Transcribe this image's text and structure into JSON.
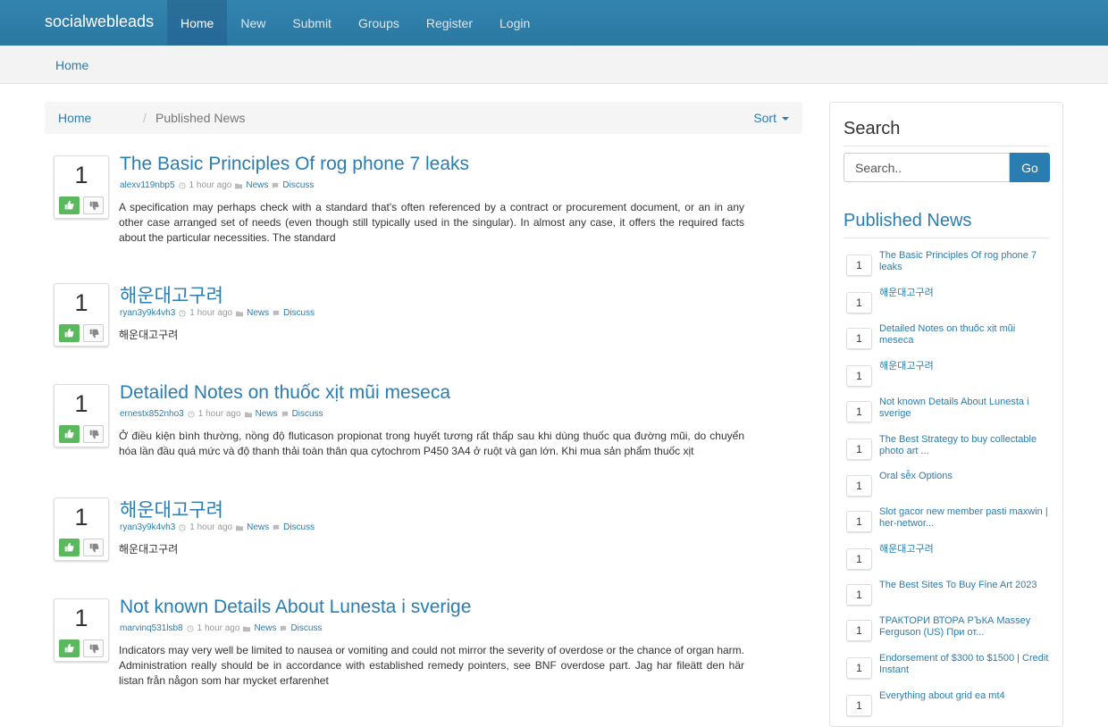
{
  "navbar": {
    "brand": "socialwebleads",
    "items": [
      "Home",
      "New",
      "Submit",
      "Groups",
      "Register",
      "Login"
    ]
  },
  "subheader": {
    "link": "Home"
  },
  "breadcrumb": {
    "home": "Home",
    "separator": "/",
    "current": "Published News",
    "sort": "Sort"
  },
  "posts": [
    {
      "votes": "1",
      "title": "The Basic Principles Of rog phone 7 leaks",
      "author": "alexv119nbp5",
      "time": "1 hour ago",
      "category": "News",
      "discuss": "Discuss",
      "excerpt": "A specification may perhaps check with a standard that's often referenced by a contract or procurement document, or an in any other case arranged set of needs (even though still typically used in the singular). In almost any case, it offers the required facts about the particular necessities. The standard"
    },
    {
      "votes": "1",
      "title": "해운대고구려",
      "author": "ryan3y9k4vh3",
      "time": "1 hour ago",
      "category": "News",
      "discuss": "Discuss",
      "excerpt": "해운대고구려"
    },
    {
      "votes": "1",
      "title": "Detailed Notes on thuốc xịt mũi meseca",
      "author": "ernestx852nho3",
      "time": "1 hour ago",
      "category": "News",
      "discuss": "Discuss",
      "excerpt": "Ở điều kiện bình thường, nồng độ fluticason propionat trong huyết tương rất thấp sau khi dùng thuốc qua đường mũi, do chuyển hóa lần đầu quá mức và độ thanh thải toàn thân qua cytochrom P450 3A4 ở ruột và gan lớn. Khi mua sản phẩm thuốc xịt"
    },
    {
      "votes": "1",
      "title": "해운대고구려",
      "author": "ryan3y9k4vh3",
      "time": "1 hour ago",
      "category": "News",
      "discuss": "Discuss",
      "excerpt": "해운대고구려"
    },
    {
      "votes": "1",
      "title": "Not known Details About Lunesta i sverige",
      "author": "marvinq531lsb8",
      "time": "1 hour ago",
      "category": "News",
      "discuss": "Discuss",
      "excerpt": "Indicators may very well be limited to nausea or vomiting and could not mirror the severity of overdose or the chance of organ harm. Administration really should be in accordance with established remedy pointers, see BNF overdose part. Jag har fileätt den här listan från någon som har mycket erfarenhet"
    }
  ],
  "sidebar": {
    "search_title": "Search",
    "search_placeholder": "Search..",
    "go_label": "Go",
    "published_title": "Published News",
    "items": [
      {
        "count": "1",
        "title": "The Basic Principles Of rog phone 7 leaks"
      },
      {
        "count": "1",
        "title": "해운대고구려"
      },
      {
        "count": "1",
        "title": "Detailed Notes on thuốc xịt mũi meseca"
      },
      {
        "count": "1",
        "title": "해운대고구려"
      },
      {
        "count": "1",
        "title": "Not known Details About Lunesta i sverige"
      },
      {
        "count": "1",
        "title": "The Best Strategy to buy collectable photo art ..."
      },
      {
        "count": "1",
        "title": "Oral sễx Options"
      },
      {
        "count": "1",
        "title": "Slot gacor new member pasti maxwin | her-networ..."
      },
      {
        "count": "1",
        "title": "해운대고구려"
      },
      {
        "count": "1",
        "title": "The Best Sites To Buy Fine Art 2023"
      },
      {
        "count": "1",
        "title": "ТРАКТОРИ ВТОРА РЪКА Massey Ferguson (US) При от..."
      },
      {
        "count": "1",
        "title": "Endorsement of $300 to $1500 | Credit Instant"
      },
      {
        "count": "1",
        "title": "Everything about grid ea mt4"
      }
    ]
  },
  "colors": {
    "navbar": "#2e7ea8",
    "link": "#2a7db0",
    "upvote": "#5cb85c"
  }
}
